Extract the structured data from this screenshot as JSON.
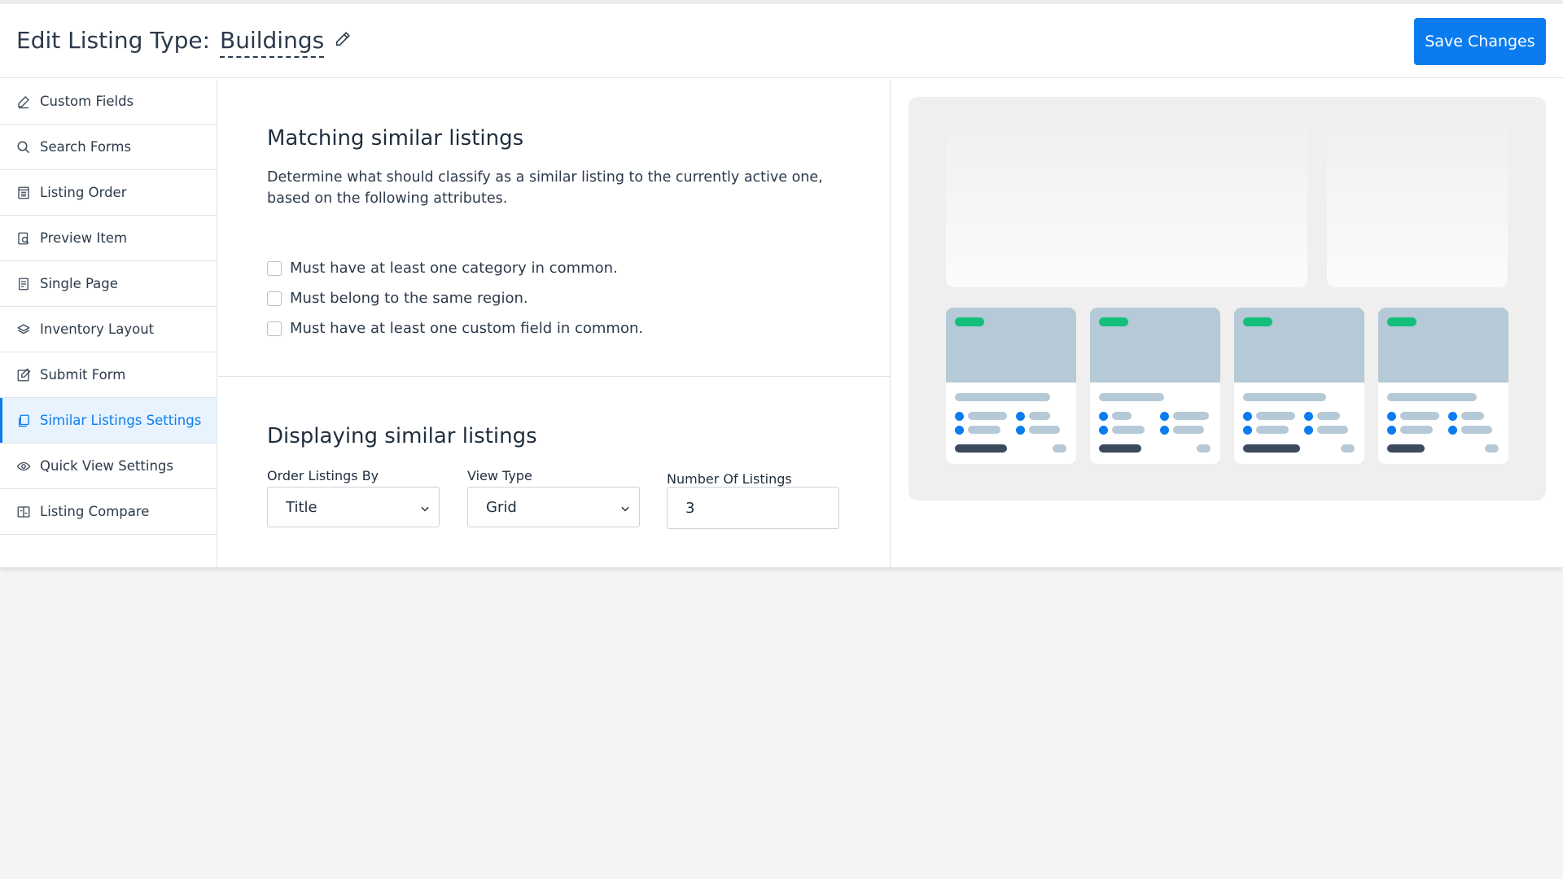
{
  "header": {
    "title_prefix": "Edit Listing Type:",
    "listing_name": "Buildings",
    "save_label": "Save Changes"
  },
  "sidebar": {
    "items": [
      {
        "label": "Custom Fields",
        "icon": "pencil-icon"
      },
      {
        "label": "Search Forms",
        "icon": "search-icon"
      },
      {
        "label": "Listing Order",
        "icon": "list-order-icon"
      },
      {
        "label": "Preview Item",
        "icon": "preview-item-icon"
      },
      {
        "label": "Single Page",
        "icon": "document-icon"
      },
      {
        "label": "Inventory Layout",
        "icon": "layers-icon"
      },
      {
        "label": "Submit Form",
        "icon": "edit-form-icon"
      },
      {
        "label": "Similar Listings Settings",
        "icon": "copy-icon",
        "active": true
      },
      {
        "label": "Quick View Settings",
        "icon": "eye-icon"
      },
      {
        "label": "Listing Compare",
        "icon": "compare-icon"
      }
    ]
  },
  "matching": {
    "title": "Matching similar listings",
    "description": "Determine what should classify as a similar listing to the currently active one, based on the following attributes.",
    "options": [
      {
        "label": "Must have at least one category in common.",
        "checked": false
      },
      {
        "label": "Must belong to the same region.",
        "checked": false
      },
      {
        "label": "Must have at least one custom field in common.",
        "checked": false
      }
    ]
  },
  "displaying": {
    "title": "Displaying similar listings",
    "order_by": {
      "label": "Order Listings By",
      "value": "Title"
    },
    "view_type": {
      "label": "View Type",
      "value": "Grid"
    },
    "number": {
      "label": "Number Of Listings",
      "value": "3"
    }
  },
  "colors": {
    "accent": "#0b7cf0",
    "tag_green": "#12bf7b",
    "card_placeholder": "#b5c9d6"
  }
}
